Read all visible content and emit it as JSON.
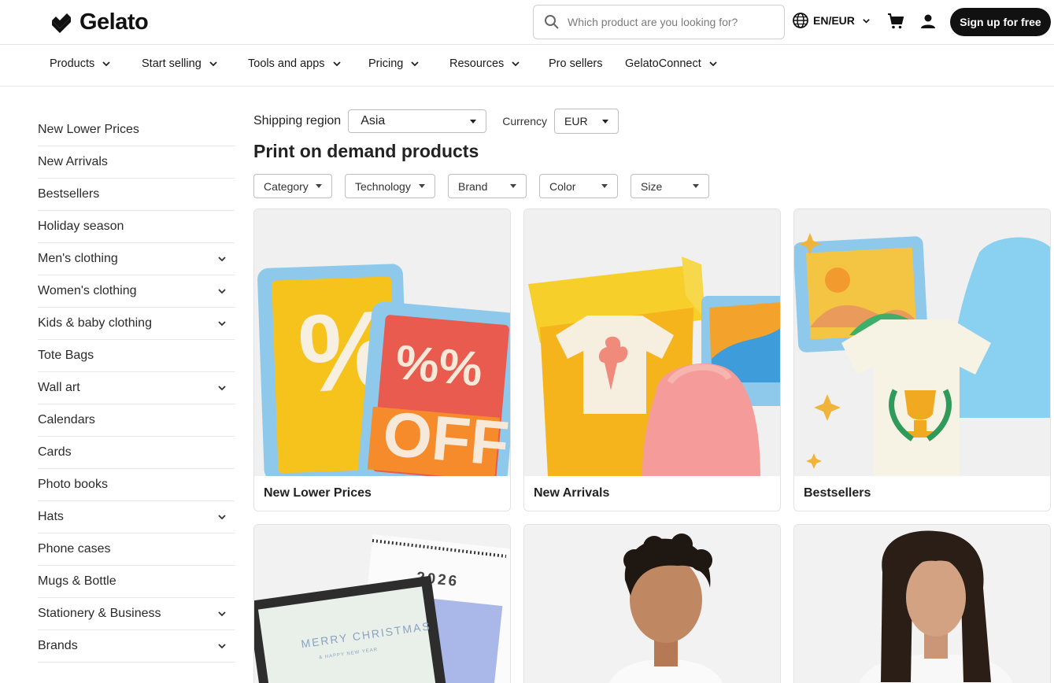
{
  "header": {
    "brand": "Gelato",
    "search_placeholder": "Which product are you looking for?",
    "language": "EN/EUR",
    "signup_label": "Sign up for free"
  },
  "nav": {
    "items": [
      "Products",
      "Start selling",
      "Tools and apps",
      "Pricing",
      "Resources",
      "Pro sellers",
      "GelatoConnect"
    ]
  },
  "sidebar": {
    "items": [
      {
        "label": "New Lower Prices",
        "expandable": false
      },
      {
        "label": "New Arrivals",
        "expandable": false
      },
      {
        "label": "Bestsellers",
        "expandable": false
      },
      {
        "label": "Holiday season",
        "expandable": false
      },
      {
        "label": "Men's clothing",
        "expandable": true
      },
      {
        "label": "Women's clothing",
        "expandable": true
      },
      {
        "label": "Kids & baby clothing",
        "expandable": true
      },
      {
        "label": "Tote Bags",
        "expandable": false
      },
      {
        "label": "Wall art",
        "expandable": true
      },
      {
        "label": "Calendars",
        "expandable": false
      },
      {
        "label": "Cards",
        "expandable": false
      },
      {
        "label": "Photo books",
        "expandable": false
      },
      {
        "label": "Hats",
        "expandable": true
      },
      {
        "label": "Phone cases",
        "expandable": false
      },
      {
        "label": "Mugs & Bottle",
        "expandable": false
      },
      {
        "label": "Stationery & Business",
        "expandable": true
      },
      {
        "label": "Brands",
        "expandable": true
      }
    ]
  },
  "filters": {
    "shipping_label": "Shipping region",
    "shipping_value": "Asia",
    "currency_label": "Currency",
    "currency_value": "EUR",
    "chips": [
      "Category",
      "Technology",
      "Brand",
      "Color",
      "Size"
    ]
  },
  "main": {
    "title": "Print on demand products",
    "cards": [
      {
        "title": "New Lower Prices"
      },
      {
        "title": "New Arrivals"
      },
      {
        "title": "Bestsellers"
      },
      {
        "title": "",
        "image_text_year": "2026",
        "image_text_greeting": "MERRY CHRISTMAS",
        "image_text_sub": "& HAPPY NEW YEAR"
      },
      {
        "title": ""
      },
      {
        "title": ""
      }
    ],
    "promo_text": {
      "pct": "%",
      "pct2": "%%",
      "off": "OFF"
    }
  },
  "colors": {
    "accent": "#111111",
    "border": "#e5e5e5"
  }
}
